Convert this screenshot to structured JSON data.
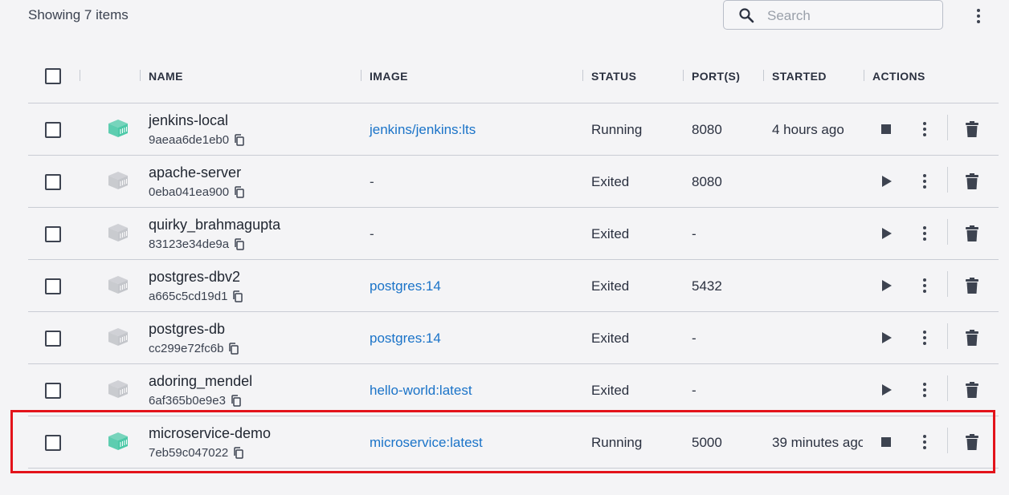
{
  "toolbar": {
    "count_label": "Showing 7 items",
    "search_placeholder": "Search",
    "search_value": ""
  },
  "columns": [
    "NAME",
    "IMAGE",
    "STATUS",
    "PORT(S)",
    "STARTED",
    "ACTIONS"
  ],
  "colors": {
    "running_icon": "#4dc9a8",
    "exited_icon": "#c4c6cb",
    "link": "#1a73c8",
    "highlight": "#e3131b"
  },
  "containers": [
    {
      "name": "jenkins-local",
      "id": "9aeaa6de1eb0",
      "image": "jenkins/jenkins:lts",
      "status": "Running",
      "ports": "8080",
      "started": "4 hours ago",
      "running": true
    },
    {
      "name": "apache-server",
      "id": "0eba041ea900",
      "image": "-",
      "status": "Exited",
      "ports": "8080",
      "started": "",
      "running": false
    },
    {
      "name": "quirky_brahmagupta",
      "id": "83123e34de9a",
      "image": "-",
      "status": "Exited",
      "ports": "-",
      "started": "",
      "running": false
    },
    {
      "name": "postgres-dbv2",
      "id": "a665c5cd19d1",
      "image": "postgres:14",
      "status": "Exited",
      "ports": "5432",
      "started": "",
      "running": false
    },
    {
      "name": "postgres-db",
      "id": "cc299e72fc6b",
      "image": "postgres:14",
      "status": "Exited",
      "ports": "-",
      "started": "",
      "running": false
    },
    {
      "name": "adoring_mendel",
      "id": "6af365b0e9e3",
      "image": "hello-world:latest",
      "status": "Exited",
      "ports": "-",
      "started": "",
      "running": false
    },
    {
      "name": "microservice-demo",
      "id": "7eb59c047022",
      "image": "microservice:latest",
      "status": "Running",
      "ports": "5000",
      "started": "39 minutes ago",
      "running": true
    }
  ]
}
